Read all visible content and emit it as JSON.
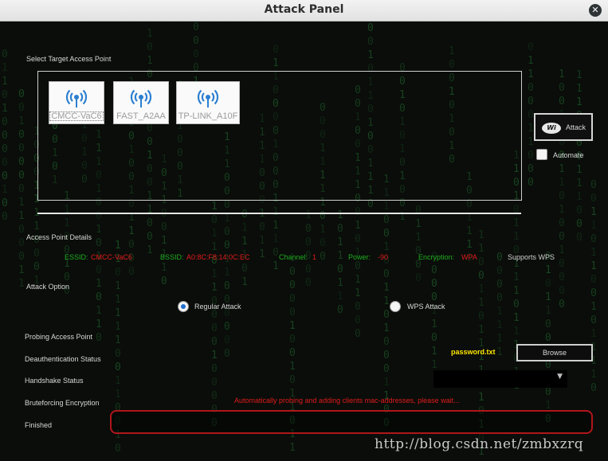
{
  "window": {
    "title": "Attack Panel",
    "close_glyph": "✕"
  },
  "target": {
    "heading": "Select Target Access Point",
    "access_points": [
      {
        "name": "CMCC-VaC6",
        "icon": "wifi-icon",
        "selected": true
      },
      {
        "name": "FAST_A2AA",
        "icon": "wifi-icon",
        "selected": false
      },
      {
        "name": "TP-LINK_A10F",
        "icon": "wifi-icon",
        "selected": false
      }
    ]
  },
  "attack_button": {
    "label": "Attack",
    "logo_text": "Wi"
  },
  "automate": {
    "label": "Automate",
    "checked": false
  },
  "details": {
    "heading": "Access Point Details",
    "essid_label": "ESSID:",
    "essid_value": "CMCC-VaC6",
    "bssid_label": "BSSID:",
    "bssid_value": "A0:8C:F8:14:0C:EC",
    "channel_label": "Channel:",
    "channel_value": "1",
    "power_label": "Power:",
    "power_value": "-90",
    "encryption_label": "Encryption:",
    "encryption_value": "WPA",
    "supports": "Supports WPS"
  },
  "attack_option": {
    "heading": "Attack Option",
    "regular_label": "Regular Attack",
    "wps_label": "WPS  Attack",
    "selected": "regular"
  },
  "progress": {
    "probing": "Probing Access Point",
    "deauth": "Deauthentication Status",
    "handshake": "Handshake Status",
    "bruteforce": "Bruteforcing Encryption",
    "finished": "Finished"
  },
  "wordlist": {
    "file": "password.txt",
    "browse_label": "Browse"
  },
  "combo": {
    "arrow": "▼"
  },
  "status_message": "Automatically probing and adding clients mac-addresses, please wait...",
  "watermark": "http://blog.csdn.net/zmbxzrq",
  "colors": {
    "accent_green": "#1fae1f",
    "accent_red": "#e21b1b",
    "file_yellow": "#ffe600"
  }
}
